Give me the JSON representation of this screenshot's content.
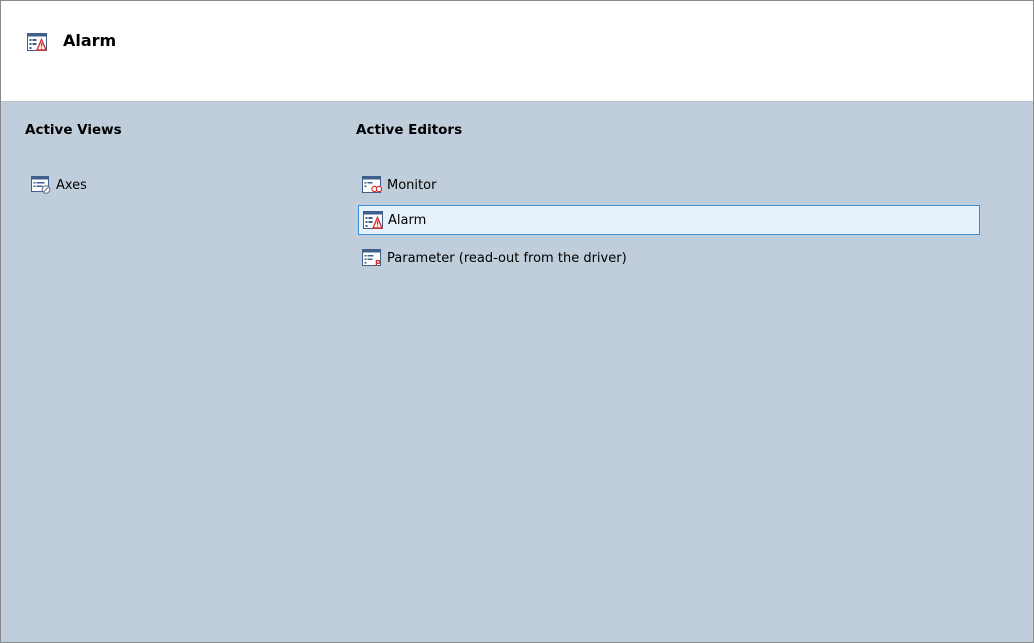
{
  "header": {
    "title": "Alarm",
    "icon": "alarm-editor-icon"
  },
  "active_views": {
    "title": "Active Views",
    "items": [
      {
        "label": "Axes",
        "icon": "axes-view-icon"
      }
    ]
  },
  "active_editors": {
    "title": "Active Editors",
    "items": [
      {
        "label": "Monitor",
        "icon": "monitor-editor-icon"
      },
      {
        "label": "Alarm",
        "icon": "alarm-editor-icon",
        "selected": true
      },
      {
        "label": "Parameter (read-out from the driver)",
        "icon": "parameter-editor-icon"
      }
    ]
  },
  "colors": {
    "panel_background": "#c0cdda",
    "header_background": "#ffffff",
    "selection_fill": "#e6f2fb",
    "selection_border": "#3a8cd6",
    "warning_red": "#d0312d"
  }
}
